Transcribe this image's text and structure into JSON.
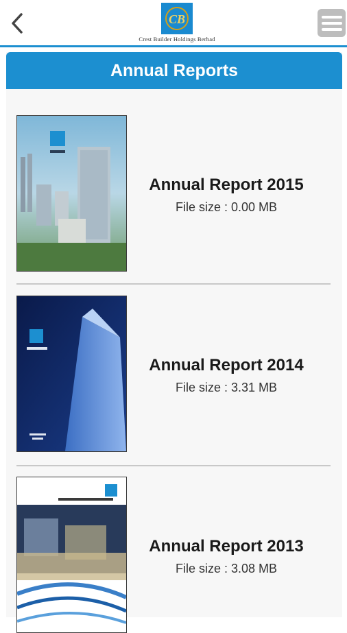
{
  "app": {
    "logo_text": "Crest Builder Holdings Berhad",
    "logo_initials": "CB",
    "colors": {
      "accent": "#1c8fd0",
      "menu_button": "#bdbdbd"
    },
    "icons": {
      "back": "chevron-left-icon",
      "menu": "hamburger-menu-icon"
    }
  },
  "page": {
    "title": "Annual Reports"
  },
  "reports": [
    {
      "title": "Annual Report 2015",
      "size": "File size : 0.00 MB"
    },
    {
      "title": "Annual Report 2014",
      "size": "File size : 3.31 MB"
    },
    {
      "title": "Annual Report 2013",
      "size": "File size : 3.08 MB"
    }
  ]
}
